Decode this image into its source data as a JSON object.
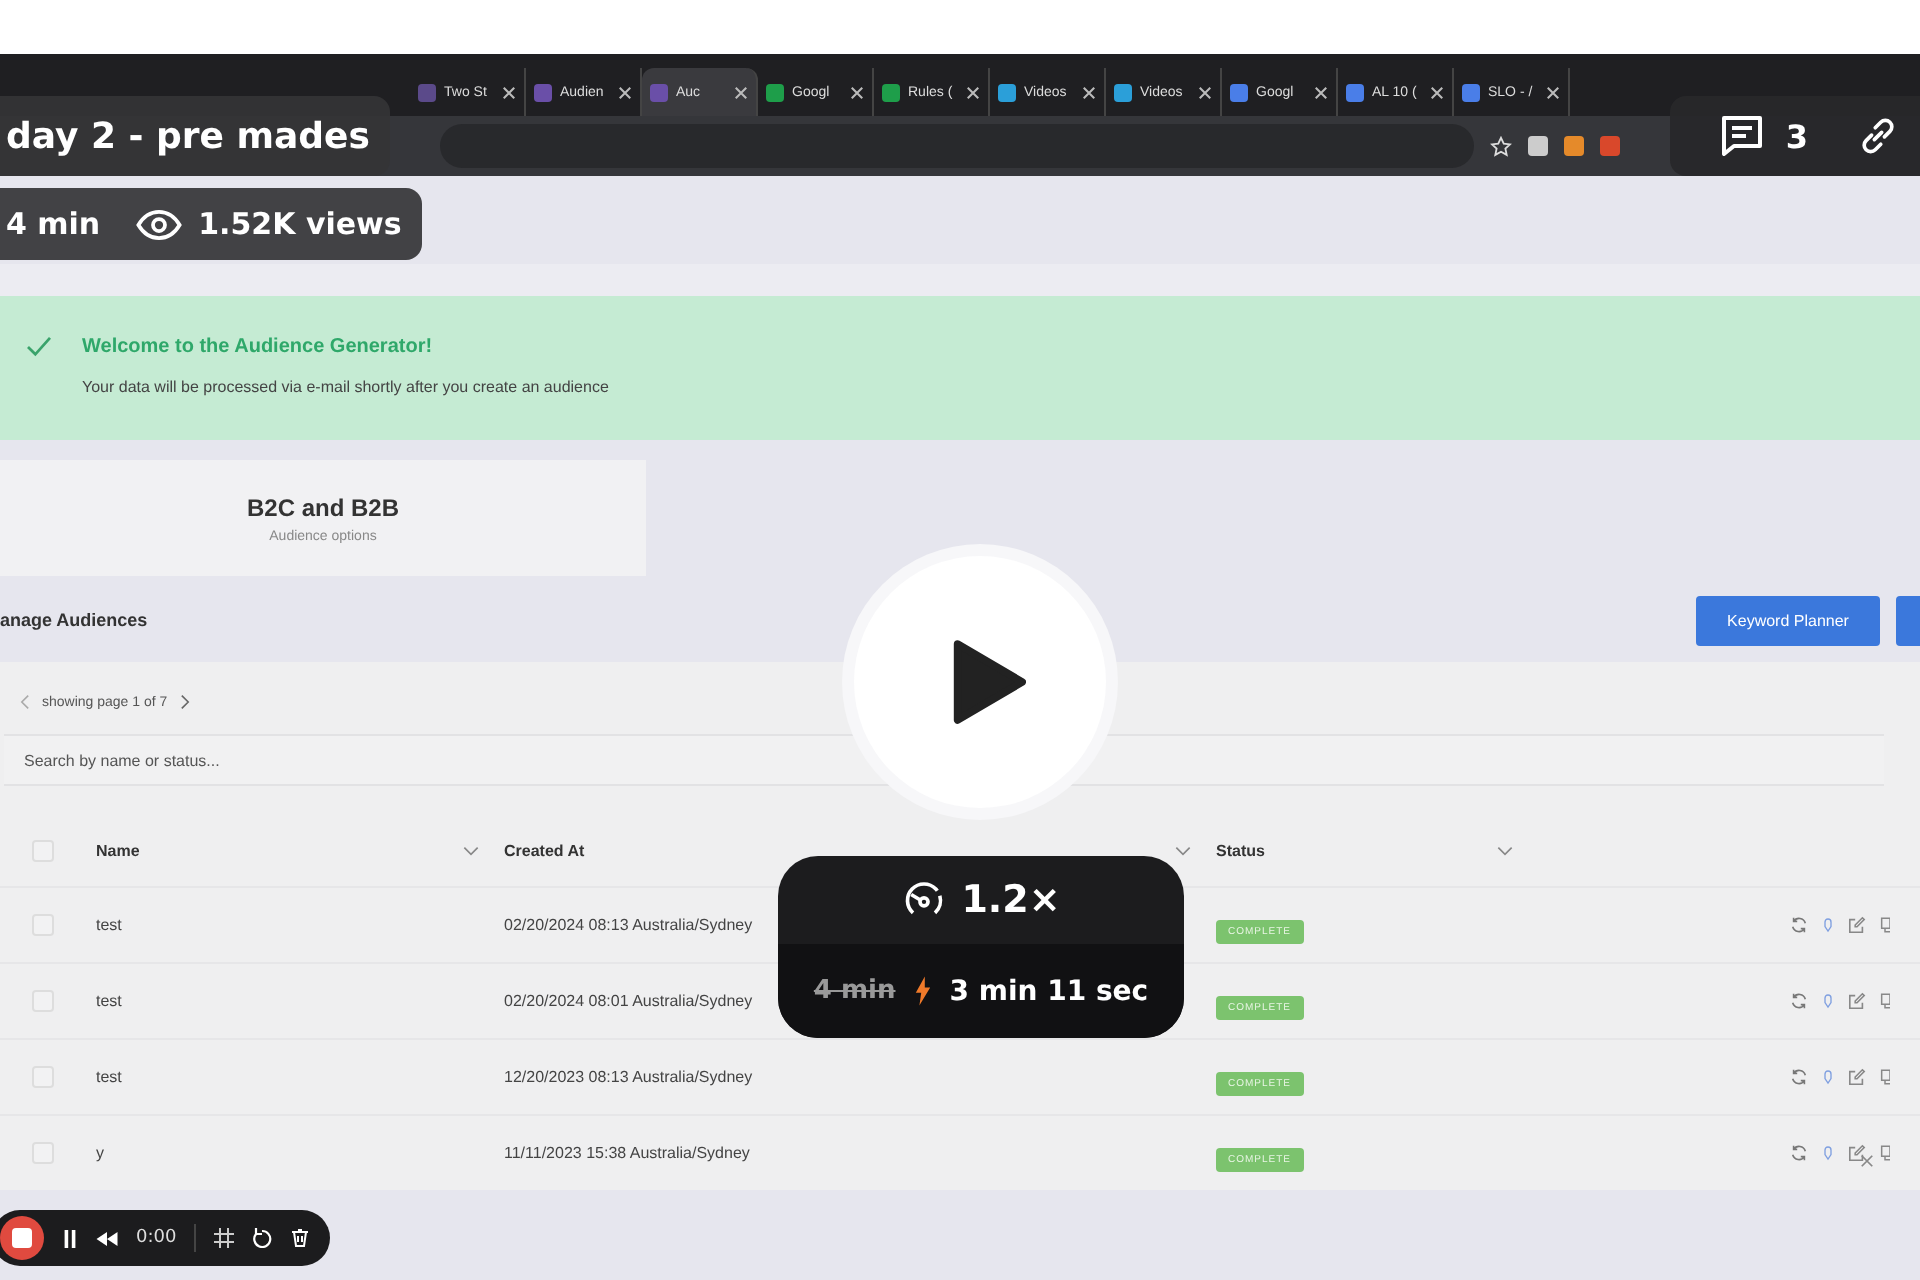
{
  "video": {
    "title": "day 2 - pre mades",
    "duration": "4 min",
    "views": "1.52K views",
    "comment_count": "3",
    "speed": "1.2×",
    "original_duration": "4 min",
    "sped_up_duration": "3 min 11 sec"
  },
  "recorder": {
    "time": "0:00"
  },
  "browser": {
    "tabs": [
      {
        "label": "Two St",
        "selected": false,
        "color": "#5b4a8a"
      },
      {
        "label": "Audien",
        "selected": false,
        "color": "#6a4fa8"
      },
      {
        "label": "Auc",
        "selected": true,
        "color": "#6a4fa8"
      },
      {
        "label": "Googl",
        "selected": false,
        "color": "#1e9e4a"
      },
      {
        "label": "Rules (",
        "selected": false,
        "color": "#1e9e4a"
      },
      {
        "label": "Videos",
        "selected": false,
        "color": "#2b9fd9"
      },
      {
        "label": "Videos",
        "selected": false,
        "color": "#2b9fd9"
      },
      {
        "label": "Googl",
        "selected": false,
        "color": "#4a7ee8"
      },
      {
        "label": "AL 10 (",
        "selected": false,
        "color": "#4a7ee8"
      },
      {
        "label": "SLO - /",
        "selected": false,
        "color": "#4a7ee8"
      }
    ]
  },
  "banner": {
    "title": "Welcome to the Audience Generator!",
    "message": "Your data will be processed via e-mail shortly after you create an audience"
  },
  "option_card": {
    "title": "B2C and B2B",
    "subtitle": "Audience options"
  },
  "section_title": "anage Audiences",
  "buttons": [
    "Keyword Planner"
  ],
  "pagination": {
    "label": "showing page 1 of 7"
  },
  "search": {
    "placeholder": "Search by name or status..."
  },
  "table": {
    "select_all_checked": false,
    "columns": [
      "Name",
      "Created At",
      "Status"
    ],
    "rows": [
      {
        "checked": false,
        "name": "test",
        "created_at": "02/20/2024 08:13 Australia/Sydney",
        "status": "COMPLETE"
      },
      {
        "checked": false,
        "name": "test",
        "created_at": "02/20/2024 08:01 Australia/Sydney",
        "status": "COMPLETE"
      },
      {
        "checked": false,
        "name": "test",
        "created_at": "12/20/2023 08:13 Australia/Sydney",
        "status": "COMPLETE"
      },
      {
        "checked": false,
        "name": "y",
        "created_at": "11/11/2023 15:38 Australia/Sydney",
        "status": "COMPLETE"
      }
    ]
  }
}
